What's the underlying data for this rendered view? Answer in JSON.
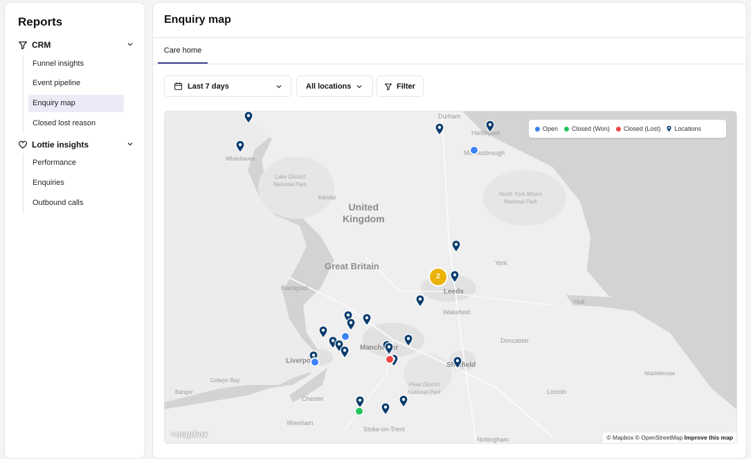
{
  "sidebar": {
    "title": "Reports",
    "groups": [
      {
        "label": "CRM",
        "icon": "filter-icon",
        "items": [
          {
            "label": "Funnel insights"
          },
          {
            "label": "Event pipeline"
          },
          {
            "label": "Enquiry map",
            "active": true
          },
          {
            "label": "Closed lost reason"
          }
        ]
      },
      {
        "label": "Lottie insights",
        "icon": "heart-icon",
        "items": [
          {
            "label": "Performance"
          },
          {
            "label": "Enquiries"
          },
          {
            "label": "Outbound calls"
          }
        ]
      }
    ]
  },
  "main": {
    "title": "Enquiry map",
    "tabs": [
      {
        "label": "Care home",
        "active": true
      }
    ],
    "toolbar": {
      "date_range": "Last 7 days",
      "locations": "All locations",
      "filter": "Filter"
    }
  },
  "map": {
    "legend": [
      {
        "label": "Open",
        "color": "#3b82f6"
      },
      {
        "label": "Closed (Won)",
        "color": "#22c55e"
      },
      {
        "label": "Closed (Lost)",
        "color": "#ef4444"
      },
      {
        "label": "Locations",
        "color": "#0b3d6e"
      }
    ],
    "cluster_count": "2",
    "place_labels": {
      "united_kingdom": "United\nKingdom",
      "great_britain": "Great Britain",
      "durham": "Durham",
      "hartlepool": "Hartlepool",
      "middlesbrough": "Middlesbrough",
      "whitehaven": "Whitehaven",
      "lake_district": "Lake District\nNational Park",
      "kendal": "Kendal",
      "north_york_moors": "North York Moors\nNational Park",
      "york": "York",
      "blackpool": "Blackpool",
      "leeds": "Leeds",
      "hull": "Hull",
      "wakefield": "Wakefield",
      "doncaster": "Doncaster",
      "manchester": "Manchester",
      "liverpool": "Liverpool",
      "sheffield": "Sheffield",
      "peak_district": "Peak District\nNational Park",
      "colwyn_bay": "Colwyn Bay",
      "bangor": "Bangor",
      "chester": "Chester",
      "wrexham": "Wrexham",
      "stoke": "Stoke-on-Trent",
      "mablethorpe": "Mablethorpe",
      "lincoln": "Lincoln",
      "nottingham": "Nottingham"
    },
    "attribution": {
      "text": "© Mapbox © OpenStreetMap",
      "link": "Improve this map",
      "logo": "mapbox"
    }
  }
}
